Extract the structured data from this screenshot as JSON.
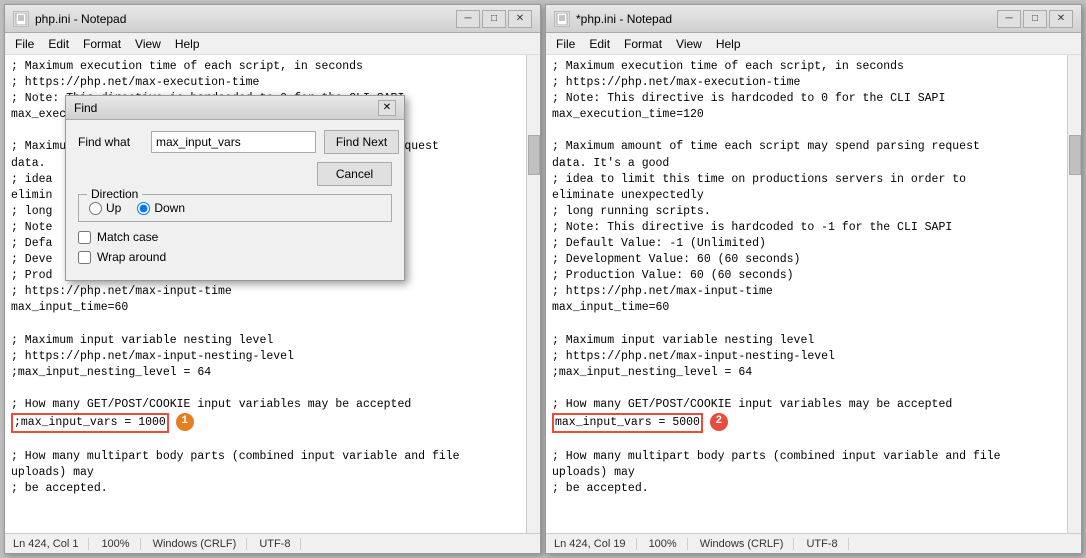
{
  "left_window": {
    "title": "php.ini - Notepad",
    "menu": [
      "File",
      "Edit",
      "Format",
      "View",
      "Help"
    ],
    "status": {
      "line_col": "Ln 424, Col 1",
      "zoom": "100%",
      "line_ending": "Windows (CRLF)",
      "encoding": "UTF-8"
    },
    "content_lines": [
      "; Maximum execution time of each script, in seconds",
      "; https://php.net/max-execution-time",
      "; Note: This directive is hardcoded to 0 for the CLI SAPI",
      "max_execution_time=120",
      "",
      "; Maximum amount of time each script may spend parsing request",
      "data.",
      "; idea",
      "elimin",
      "; long",
      "; Note",
      "; Defa",
      "; Deve",
      "; Prod",
      "; https://php.net/max-input-time",
      "max_input_time=60",
      "",
      "; Maximum input variable nesting level",
      "; https://php.net/max-input-nesting-level",
      ";max_input_nesting_level = 64",
      "",
      "; How many GET/POST/COOKIE input variables may be accepted",
      ";max_input_vars = 1000",
      "",
      "; How many multipart body parts (combined input variable and file",
      "uploads) may",
      "; be accepted."
    ],
    "highlighted_line": ";max_input_vars = 1000",
    "badge": "1"
  },
  "right_window": {
    "title": "*php.ini - Notepad",
    "menu": [
      "File",
      "Edit",
      "Format",
      "View",
      "Help"
    ],
    "status": {
      "line_col": "Ln 424, Col 19",
      "zoom": "100%",
      "line_ending": "Windows (CRLF)",
      "encoding": "UTF-8"
    },
    "content_lines": [
      "; Maximum execution time of each script, in seconds",
      "; https://php.net/max-execution-time",
      "; Note: This directive is hardcoded to 0 for the CLI SAPI",
      "max_execution_time=120",
      "",
      "; Maximum amount of time each script may spend parsing request",
      "data. It's a good",
      "; idea to limit this time on productions servers in order to",
      "eliminate unexpectedly",
      "; long running scripts.",
      "; Note: This directive is hardcoded to -1 for the CLI SAPI",
      "; Default Value: -1 (Unlimited)",
      "; Development Value: 60 (60 seconds)",
      "; Production Value: 60 (60 seconds)",
      "; https://php.net/max-input-time",
      "max_input_time=60",
      "",
      "; Maximum input variable nesting level",
      "; https://php.net/max-input-nesting-level",
      ";max_input_nesting_level = 64",
      "",
      "; How many GET/POST/COOKIE input variables may be accepted",
      "max_input_vars = 5000",
      "",
      "; How many multipart body parts (combined input variable and file",
      "uploads) may",
      "; be accepted."
    ],
    "highlighted_line": "max_input_vars = 5000",
    "badge": "2"
  },
  "find_dialog": {
    "title": "Find",
    "find_what_label": "Find what",
    "find_what_value": "max_input_vars",
    "find_next_label": "Find Next",
    "cancel_label": "Cancel",
    "direction_label": "Direction",
    "up_label": "Up",
    "down_label": "Down",
    "match_case_label": "Match case",
    "wrap_around_label": "Wrap around",
    "direction_selected": "down"
  }
}
